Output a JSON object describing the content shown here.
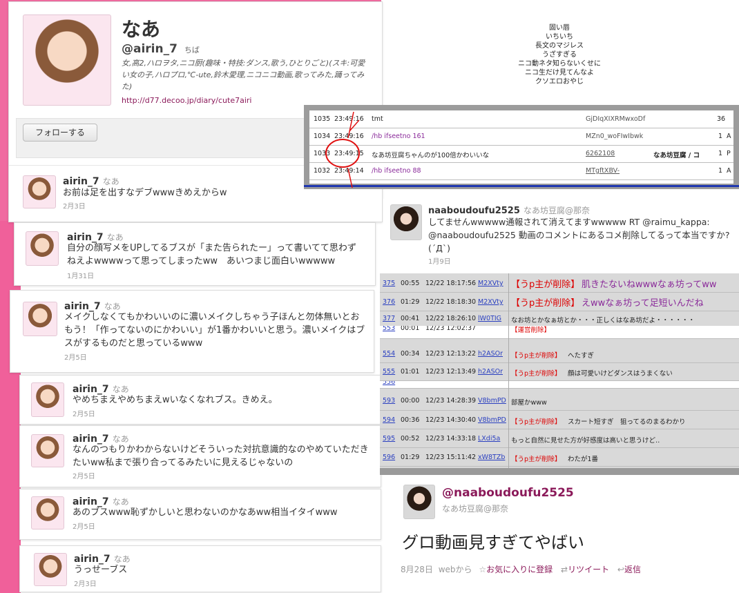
{
  "profile": {
    "display_name": "なあ",
    "handle": "@airin_7",
    "location": "ちば",
    "bio": "女,高2,ハロヲタ,ニコ厨(趣味・特技:ダンス,歌う,ひとりごと)(スキ:可愛い女の子,ハロプロ,℃-ute,鈴木愛理,ニコニコ動画,歌ってみた,踊ってみた)",
    "url": "http://d77.decoo.jp/diary/cute7airi",
    "follow_button": "フォローする"
  },
  "tweets": [
    {
      "user": "airin_7",
      "name": "なあ",
      "text": "お前は足を出すなデブwwwきめえからw",
      "date": "2月3日"
    },
    {
      "user": "airin_7",
      "name": "なあ",
      "text": "自分の顔写メをUPしてるブスが「また告られたー」って書いてて思わず　ねえよwwwwって思ってしまったww　あいつまじ面白いwwwww",
      "date": "1月31日"
    },
    {
      "user": "airin_7",
      "name": "なあ",
      "text": "メイクしなくてもかわいいのに濃いメイクしちゃう子ほんと勿体無いとおもう！「作ってないのにかわいい」が1番かわいいと思う。濃いメイクはブスがするものだと思っているwww",
      "date": "2月5日"
    },
    {
      "user": "airin_7",
      "name": "なあ",
      "text": "やめちまえやめちまえwいなくなれブス。きめえ。",
      "date": "2月5日"
    },
    {
      "user": "airin_7",
      "name": "なあ",
      "text": "なんのつもりかわからないけどそういった対抗意識的なのやめていただきたいww私まで張り合ってるみたいに見えるじゃないの",
      "date": "2月5日"
    },
    {
      "user": "airin_7",
      "name": "なあ",
      "text": "あのブスwww恥ずかしいと思わないのかなあww相当イタイwww",
      "date": "2月5日"
    },
    {
      "user": "airin_7",
      "name": "なあ",
      "text": "うっせーブス",
      "date": "2月3日"
    }
  ],
  "poem": [
    "固い唇",
    "いちいち",
    "長文のマジレス",
    "うざすぎる",
    "ニコ動ネタ知らないくせに",
    "ニコ生だけ見てんなよ",
    "クソエロおやじ"
  ],
  "log_top": [
    {
      "no": "1035",
      "time": "23:49:16",
      "msg": "tmt",
      "id": "GjDIqXIXRMwxoDf",
      "c1": "36",
      "c2": ""
    },
    {
      "no": "1034",
      "time": "23:49:16",
      "msg": "/hb ifseetno 161",
      "id": "MZn0_woFIwIbwk",
      "c1": "1",
      "c2": "A"
    },
    {
      "no": "1033",
      "time": "23:49:15",
      "msg": "なあ坊豆腐ちゃんのが100倍かわいいな",
      "id": "6262108",
      "tag": "なあ坊豆腐 / コ",
      "c1": "1",
      "c2": "P"
    },
    {
      "no": "1032",
      "time": "23:49:14",
      "msg": "/hb ifseetno 88",
      "id": "MTgftXBV-",
      "c1": "1",
      "c2": "A"
    }
  ],
  "mid_tweet": {
    "user": "naaboudoufu2525",
    "name": "なあ坊豆腐@那奈",
    "text": "してませんwwwww通報されて消えてますwwwww RT @raimu_kappa: @naaboudoufu2525 動画のコメントにあるコメ削除してるって本当ですか?(´Д`)",
    "date": "1月9日"
  },
  "comments": [
    {
      "no": "375",
      "pos": "00:55",
      "date": "12/22 18:17:56",
      "id": "M2XVty",
      "tag": "【うp主が削除】",
      "msg": "肌きたないねwwwなぁ坊ってww",
      "big": true
    },
    {
      "no": "376",
      "pos": "01:29",
      "date": "12/22 18:18:30",
      "id": "M2XVty",
      "tag": "【うp主が削除】",
      "msg": "えwwなぁ坊って足短いんだね",
      "big": true
    },
    {
      "no": "377",
      "pos": "00:41",
      "date": "12/22 18:26:10",
      "id": "lW0TIG",
      "tag": "",
      "msg": "なお坊とかなぁ坊とか・・・正しくはなあ坊だよ・・・・・・",
      "big": false
    },
    {
      "no": "553",
      "pos": "00:01",
      "date": "12/23 12:02:37",
      "id": "",
      "tag": "【運営削除】",
      "msg": "",
      "big": false
    },
    {
      "no": "554",
      "pos": "00:34",
      "date": "12/23 12:13:22",
      "id": "h2ASOr",
      "tag": "【うp主が削除】",
      "msg": "へたすぎ",
      "big": false
    },
    {
      "no": "555",
      "pos": "01:01",
      "date": "12/23 12:13:49",
      "id": "h2ASOr",
      "tag": "【うp主が削除】",
      "msg": "顔は可愛いけどダンスはうまくない",
      "big": false
    },
    {
      "no": "556",
      "pos": "",
      "date": "",
      "id": "",
      "tag": "",
      "msg": "",
      "big": false
    },
    {
      "no": "593",
      "pos": "00:00",
      "date": "12/23 14:28:39",
      "id": "V8bmPD",
      "tag": "",
      "msg": "部屋かwww",
      "big": false
    },
    {
      "no": "594",
      "pos": "00:36",
      "date": "12/23 14:30:40",
      "id": "V8bmPD",
      "tag": "【うp主が削除】",
      "msg": "スカート短すぎ　狙ってるのまるわかり",
      "big": false
    },
    {
      "no": "595",
      "pos": "00:52",
      "date": "12/23 14:33:18",
      "id": "LXdi5a",
      "tag": "",
      "msg": "もっと自然に見せた方が好感度は高いと思うけど‥",
      "big": false
    },
    {
      "no": "596",
      "pos": "01:29",
      "date": "12/23 15:11:42",
      "id": "xW8TZb",
      "tag": "【うp主が削除】",
      "msg": "わたが1番",
      "big": false
    }
  ],
  "bottom_tweet": {
    "handle": "@naaboudoufu2525",
    "name": "なあ坊豆腐@那奈",
    "text": "グロ動画見すぎてやばい",
    "date": "8月28日",
    "via": "webから",
    "fav": "お気に入りに登録",
    "rt": "リツイート",
    "reply": "返信"
  }
}
